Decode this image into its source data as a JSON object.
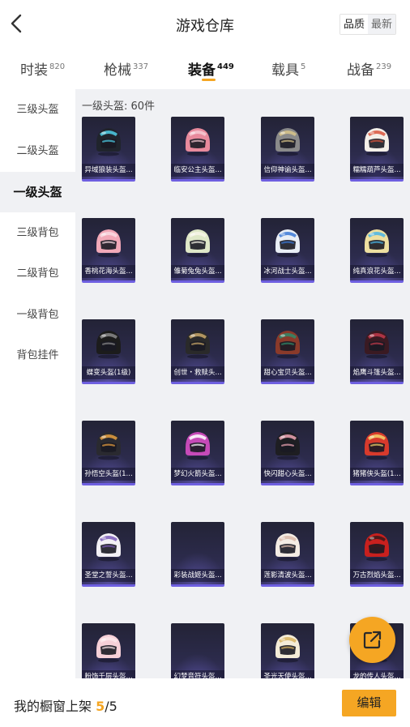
{
  "header": {
    "title": "游戏仓库",
    "sort_options": [
      "品质",
      "最新"
    ],
    "sort_selected": "品质"
  },
  "tabs": [
    {
      "label": "时装",
      "count": "820"
    },
    {
      "label": "枪械",
      "count": "337"
    },
    {
      "label": "装备",
      "count": "449",
      "active": true
    },
    {
      "label": "载具",
      "count": "5"
    },
    {
      "label": "战备",
      "count": "239"
    }
  ],
  "sidebar": {
    "items": [
      {
        "label": "三级头盔"
      },
      {
        "label": "二级头盔"
      },
      {
        "label": "一级头盔",
        "active": true
      },
      {
        "label": "三级背包"
      },
      {
        "label": "二级背包"
      },
      {
        "label": "一级背包"
      },
      {
        "label": "背包挂件"
      }
    ]
  },
  "content": {
    "section_label": "一级头盔: 60件",
    "items": [
      {
        "name": "异域狼装头盔...",
        "icon": "helmet-icon",
        "colors": [
          "#20242c",
          "#4fd0e8"
        ]
      },
      {
        "name": "临安公主头盔...",
        "icon": "helmet-icon",
        "colors": [
          "#e88a9c",
          "#f6c9d2"
        ]
      },
      {
        "name": "信仰神谕头盔...",
        "icon": "helmet-icon",
        "colors": [
          "#8a8a8a",
          "#d8c48a"
        ]
      },
      {
        "name": "糯糯葫芦头盔...",
        "icon": "helmet-icon",
        "colors": [
          "#f4efe8",
          "#d9533b"
        ]
      },
      {
        "name": "香桃花海头盔...",
        "icon": "helmet-icon",
        "colors": [
          "#f2a9b8",
          "#f9dbe2"
        ]
      },
      {
        "name": "雏菊兔兔头盔...",
        "icon": "helmet-icon",
        "colors": [
          "#dfe8c8",
          "#f7f5e8"
        ]
      },
      {
        "name": "冰河战士头盔...",
        "icon": "helmet-icon",
        "colors": [
          "#e9eef5",
          "#3b78d6"
        ]
      },
      {
        "name": "纯真浪花头盔...",
        "icon": "helmet-icon",
        "colors": [
          "#eedfa0",
          "#4ab5e6"
        ]
      },
      {
        "name": "蝶变头盔(1级)",
        "icon": "helmet-icon",
        "colors": [
          "#1c1c1c",
          "#8a8a8a"
        ]
      },
      {
        "name": "创世・救赎头...",
        "icon": "helmet-icon",
        "colors": [
          "#2a2a2a",
          "#c9a86a"
        ]
      },
      {
        "name": "甜心宝贝头盔...",
        "icon": "helmet-icon",
        "colors": [
          "#8a3a2a",
          "#2f8a6a"
        ]
      },
      {
        "name": "焰鹰斗篷头盔...",
        "icon": "helmet-icon",
        "colors": [
          "#3a1a22",
          "#c23a4a"
        ]
      },
      {
        "name": "孙悟空头盔(1...",
        "icon": "helmet-icon",
        "colors": [
          "#2a2a30",
          "#e8a040"
        ]
      },
      {
        "name": "梦幻火箭头盔...",
        "icon": "helmet-icon",
        "colors": [
          "#c64ab8",
          "#ffffff"
        ]
      },
      {
        "name": "快闪甜心头盔...",
        "icon": "helmet-icon",
        "colors": [
          "#1e1e22",
          "#f0a6b4"
        ]
      },
      {
        "name": "猪猪侠头盔(1...",
        "icon": "helmet-icon",
        "colors": [
          "#d73a2c",
          "#f3d36a"
        ]
      },
      {
        "name": "圣堂之誓头盔...",
        "icon": "helmet-icon",
        "colors": [
          "#f2f0f5",
          "#7a5ab8"
        ]
      },
      {
        "name": "彩装战姬头盔...",
        "icon": "helmet-icon",
        "colors": [],
        "empty": true
      },
      {
        "name": "莲影清波头盔...",
        "icon": "helmet-icon",
        "colors": [
          "#f4ece4",
          "#d9b8a8"
        ]
      },
      {
        "name": "万古烈焰头盔...",
        "icon": "helmet-icon",
        "colors": [
          "#c8201e",
          "#3a1a1a"
        ]
      },
      {
        "name": "粉饰千层头盔...",
        "icon": "helmet-icon",
        "colors": [
          "#f6d0d8",
          "#fbe6ea"
        ]
      },
      {
        "name": "幻梦音符头盔...",
        "icon": "helmet-icon",
        "colors": [],
        "empty": true
      },
      {
        "name": "圣光天使头盔...",
        "icon": "helmet-icon",
        "colors": [
          "#f4ecd8",
          "#d8b460"
        ]
      },
      {
        "name": "龙的传人头盔...",
        "icon": "helmet-icon",
        "colors": [
          "#c8201e",
          "#f0c040"
        ]
      }
    ]
  },
  "bottom_bar": {
    "showcase_label": "我的橱窗上架",
    "count_current": "5",
    "count_sep": "/",
    "count_total": "5",
    "edit_label": "编辑"
  },
  "colors": {
    "accent": "#f5a623",
    "content_bg": "#f0f1f4",
    "card_border": "#6e5fe0"
  }
}
